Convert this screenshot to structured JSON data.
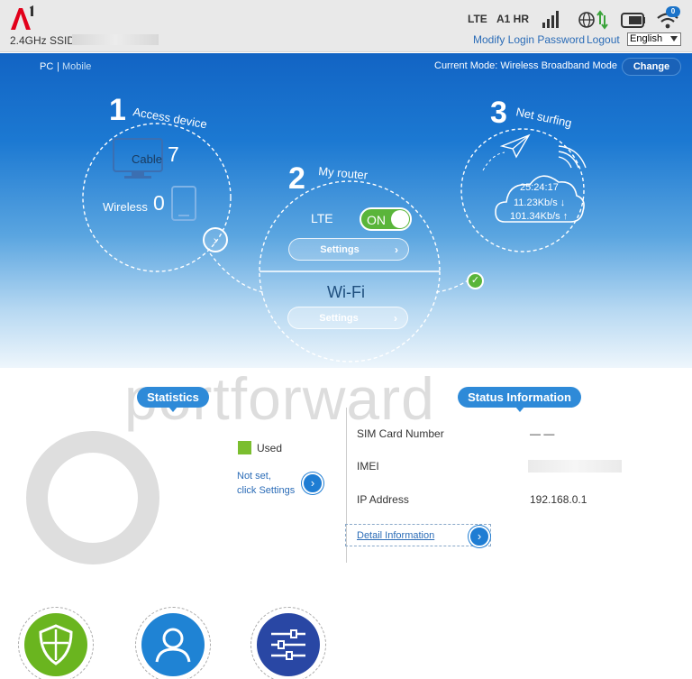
{
  "header": {
    "logo_text": "A1",
    "ssid_label": "2.4GHz SSID:",
    "indicators": {
      "lte": "LTE",
      "network": "A1 HR"
    },
    "wifi_count": "0",
    "modify_password": "Modify Login Password",
    "logout": "Logout",
    "language": "English"
  },
  "mode": {
    "pc": "PC",
    "separator": "|",
    "mobile": "Mobile",
    "current_mode": "Current Mode: Wireless Broadband Mode",
    "change": "Change"
  },
  "steps": {
    "access_device": {
      "number": "1",
      "title": "Access device",
      "cable_label": "Cable",
      "cable_count": "7",
      "wireless_label": "Wireless",
      "wireless_count": "0"
    },
    "my_router": {
      "number": "2",
      "title": "My router",
      "lte_label": "LTE",
      "lte_toggle": "ON",
      "lte_settings": "Settings",
      "wifi_label": "Wi-Fi",
      "wifi_settings": "Settings"
    },
    "net_surfing": {
      "number": "3",
      "title": "Net surfing",
      "uptime": "25:24:17",
      "download": "11.23Kb/s ↓",
      "upload": "101.34Kb/s ↑"
    }
  },
  "watermark": "portforward",
  "statistics": {
    "title": "Statistics",
    "legend_used": "Used",
    "not_set_line1": "Not set,",
    "not_set_line2": "click Settings"
  },
  "status": {
    "title": "Status Information",
    "rows": [
      {
        "label": "SIM Card Number",
        "value": "— —"
      },
      {
        "label": "IMEI",
        "value": ""
      },
      {
        "label": "IP Address",
        "value": "192.168.0.1"
      }
    ],
    "detail_link": "Detail Information"
  },
  "icons": {
    "security": "shield-icon",
    "user": "person-icon",
    "settings": "sliders-icon"
  },
  "colors": {
    "accent_blue": "#1f7dd3",
    "on_green": "#5ab53a",
    "brand_red": "#e2001a",
    "security_green": "#6ab51f",
    "settings_navy": "#2947a4"
  }
}
